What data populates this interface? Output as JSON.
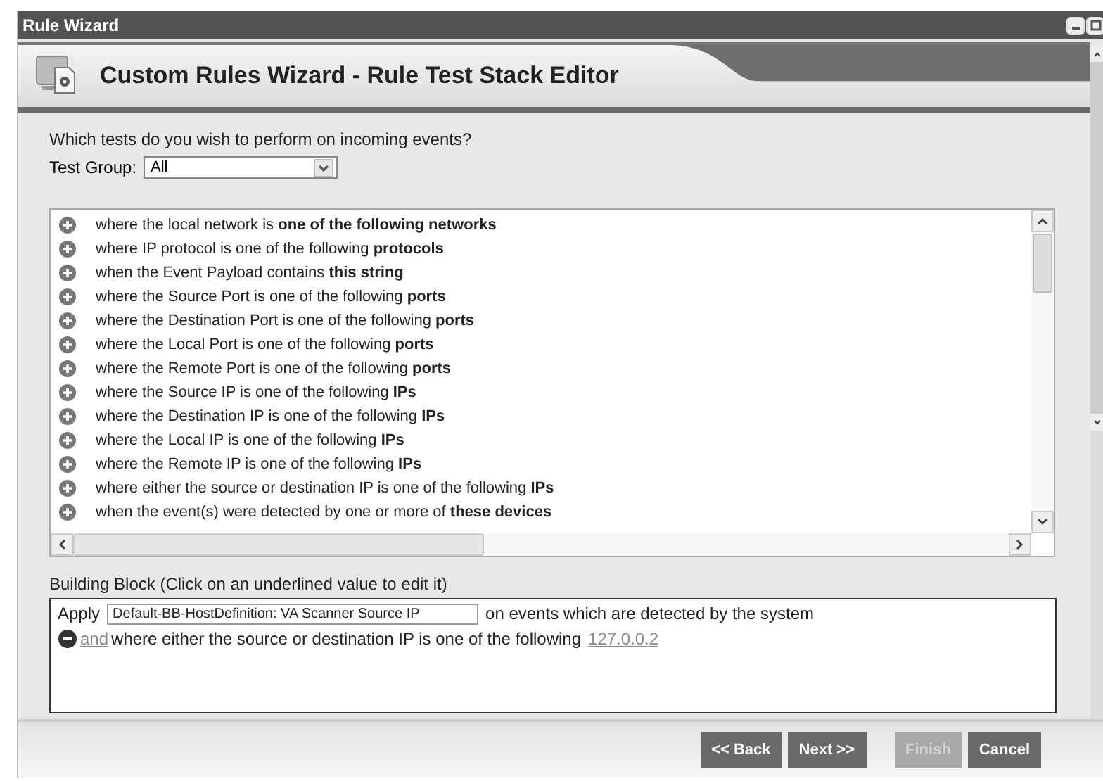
{
  "window": {
    "title": "Rule Wizard"
  },
  "header": {
    "title": "Custom Rules Wizard - Rule Test Stack Editor"
  },
  "prompt": "Which tests do you wish to perform on incoming events?",
  "test_group": {
    "label": "Test Group:",
    "value": "All"
  },
  "tests": [
    {
      "text": "where the local network is **one of the following networks**"
    },
    {
      "text": "where IP protocol is one of the following **protocols**"
    },
    {
      "text": "when the Event Payload contains **this string**"
    },
    {
      "text": "where the Source Port is one of the following **ports**"
    },
    {
      "text": "where the Destination Port is one of the following **ports**"
    },
    {
      "text": "where the Local Port is one of the following **ports**"
    },
    {
      "text": "where the Remote Port is one of the following **ports**"
    },
    {
      "text": "where the Source IP is one of the following **IPs**"
    },
    {
      "text": "where the Destination IP is one of the following **IPs**"
    },
    {
      "text": "where the Local IP is one of the following **IPs**"
    },
    {
      "text": "where the Remote IP is one of the following **IPs**"
    },
    {
      "text": "where either the source or destination IP is one of the following **IPs**"
    },
    {
      "text": "when the event(s) were detected by one or more of **these devices**"
    }
  ],
  "building_block": {
    "label": "Building Block (Click on an underlined value to edit it)",
    "apply": "Apply",
    "rule_name": "Default-BB-HostDefinition: VA Scanner Source IP",
    "apply_suffix": "on events which are detected by the system",
    "conditions": [
      {
        "joiner": "and",
        "text": "where either the source or destination IP is one of the following",
        "value": "127.0.0.2"
      }
    ]
  },
  "buttons": [
    {
      "label": "<< Back",
      "disabled": false
    },
    {
      "label": "Next >>",
      "disabled": false
    },
    {
      "label": "Finish",
      "disabled": true
    },
    {
      "label": "Cancel",
      "disabled": false
    }
  ]
}
